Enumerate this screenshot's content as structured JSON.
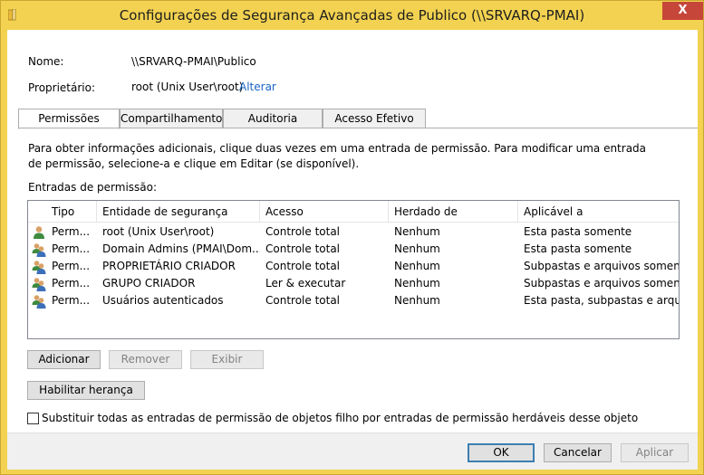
{
  "window": {
    "title": "Configurações de Segurança Avançadas de Publico (\\\\SRVARQ-PMAI)",
    "close_glyph": "X"
  },
  "info": {
    "name_label": "Nome:",
    "name_value": "\\\\SRVARQ-PMAI\\Publico",
    "owner_label": "Proprietário:",
    "owner_value": "root (Unix User\\root)",
    "owner_link": "Alterar"
  },
  "tabs": [
    {
      "label": "Permissões",
      "active": true
    },
    {
      "label": "Compartilhamento"
    },
    {
      "label": "Auditoria"
    },
    {
      "label": "Acesso Efetivo"
    }
  ],
  "panel": {
    "description": "Para obter informações adicionais, clique duas vezes em uma entrada de permissão. Para modificar uma entrada de permissão, selecione-a e clique em Editar (se disponível).",
    "entries_label": "Entradas de permissão:"
  },
  "table": {
    "columns": [
      "Tipo",
      "Entidade de segurança",
      "Acesso",
      "Herdado de",
      "Aplicável a"
    ],
    "rows": [
      {
        "icon": "user-icon",
        "tipo": "Perm...",
        "entidade": "root (Unix User\\root)",
        "acesso": "Controle total",
        "herdado": "Nenhum",
        "aplicavel": "Esta pasta somente"
      },
      {
        "icon": "group-icon",
        "tipo": "Perm...",
        "entidade": "Domain Admins (PMAI\\Dom...",
        "acesso": "Controle total",
        "herdado": "Nenhum",
        "aplicavel": "Esta pasta somente"
      },
      {
        "icon": "group-icon",
        "tipo": "Perm...",
        "entidade": "PROPRIETÁRIO CRIADOR",
        "acesso": "Controle total",
        "herdado": "Nenhum",
        "aplicavel": "Subpastas e arquivos somente"
      },
      {
        "icon": "group-icon",
        "tipo": "Perm...",
        "entidade": "GRUPO CRIADOR",
        "acesso": "Ler & executar",
        "herdado": "Nenhum",
        "aplicavel": "Subpastas e arquivos somente"
      },
      {
        "icon": "group-icon",
        "tipo": "Perm...",
        "entidade": "Usuários autenticados",
        "acesso": "Controle total",
        "herdado": "Nenhum",
        "aplicavel": "Esta pasta, subpastas e arquivos"
      }
    ]
  },
  "buttons": {
    "add": "Adicionar",
    "remove": "Remover",
    "view": "Exibir",
    "enable_inheritance": "Habilitar herança",
    "ok": "OK",
    "cancel": "Cancelar",
    "apply": "Aplicar"
  },
  "checkbox": {
    "label": "Substituir todas as entradas de permissão de objetos filho por entradas de permissão herdáveis desse objeto",
    "checked": false
  }
}
